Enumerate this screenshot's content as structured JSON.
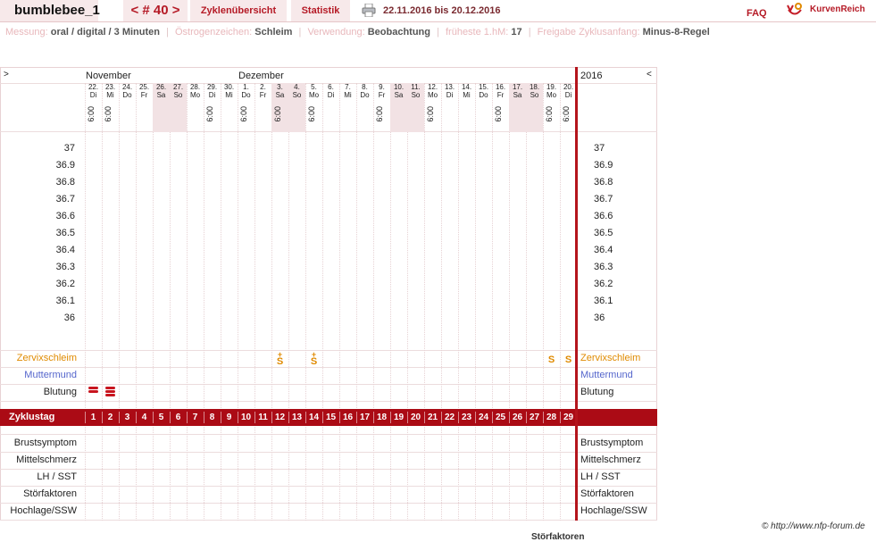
{
  "header": {
    "username": "bumblebee_1",
    "cycle_nav": {
      "prev": "<",
      "label": "# 40",
      "next": ">"
    },
    "tabs": [
      "Zyklenübersicht",
      "Statistik"
    ],
    "date_range": "22.11.2016 bis 20.12.2016",
    "faq": "FAQ",
    "brand": "KurvenReich"
  },
  "info": {
    "measure_label": "Messung:",
    "measure_value": "oral / digital / 3 Minuten",
    "estrogen_label": "Östrogenzeichen:",
    "estrogen_value": "Schleim",
    "usage_label": "Verwendung:",
    "usage_value": "Beobachtung",
    "earliest_label": "früheste 1.hM:",
    "earliest_value": "17",
    "release_label": "Freigabe Zyklusanfang:",
    "release_value": "Minus-8-Regel"
  },
  "chart": {
    "left_arrow": ">",
    "right_arrow": "<",
    "month1": "November",
    "month2": "Dezember",
    "year": "2016",
    "days": [
      {
        "d": "22.",
        "w": "Di",
        "t": "6:00",
        "we": false
      },
      {
        "d": "23.",
        "w": "Mi",
        "t": "6:00",
        "we": false
      },
      {
        "d": "24.",
        "w": "Do",
        "t": "",
        "we": false
      },
      {
        "d": "25.",
        "w": "Fr",
        "t": "",
        "we": false
      },
      {
        "d": "26.",
        "w": "Sa",
        "t": "",
        "we": true
      },
      {
        "d": "27.",
        "w": "So",
        "t": "",
        "we": true
      },
      {
        "d": "28.",
        "w": "Mo",
        "t": "",
        "we": false
      },
      {
        "d": "29.",
        "w": "Di",
        "t": "6:00",
        "we": false
      },
      {
        "d": "30.",
        "w": "Mi",
        "t": "",
        "we": false
      },
      {
        "d": "1.",
        "w": "Do",
        "t": "6:00",
        "we": false
      },
      {
        "d": "2.",
        "w": "Fr",
        "t": "",
        "we": false
      },
      {
        "d": "3.",
        "w": "Sa",
        "t": "6:00",
        "we": true
      },
      {
        "d": "4.",
        "w": "So",
        "t": "",
        "we": true
      },
      {
        "d": "5.",
        "w": "Mo",
        "t": "6:00",
        "we": false
      },
      {
        "d": "6.",
        "w": "Di",
        "t": "",
        "we": false
      },
      {
        "d": "7.",
        "w": "Mi",
        "t": "",
        "we": false
      },
      {
        "d": "8.",
        "w": "Do",
        "t": "",
        "we": false
      },
      {
        "d": "9.",
        "w": "Fr",
        "t": "6:00",
        "we": false
      },
      {
        "d": "10.",
        "w": "Sa",
        "t": "",
        "we": true
      },
      {
        "d": "11.",
        "w": "So",
        "t": "",
        "we": true
      },
      {
        "d": "12.",
        "w": "Mo",
        "t": "6:00",
        "we": false
      },
      {
        "d": "13.",
        "w": "Di",
        "t": "",
        "we": false
      },
      {
        "d": "14.",
        "w": "Mi",
        "t": "",
        "we": false
      },
      {
        "d": "15.",
        "w": "Do",
        "t": "",
        "we": false
      },
      {
        "d": "16.",
        "w": "Fr",
        "t": "6:00",
        "we": false
      },
      {
        "d": "17.",
        "w": "Sa",
        "t": "",
        "we": true
      },
      {
        "d": "18.",
        "w": "So",
        "t": "",
        "we": true
      },
      {
        "d": "19.",
        "w": "Mo",
        "t": "6:00",
        "we": false
      },
      {
        "d": "20.",
        "w": "Di",
        "t": "6:00",
        "we": false
      }
    ],
    "temps": [
      "37",
      "36.9",
      "36.8",
      "36.7",
      "36.6",
      "36.5",
      "36.4",
      "36.3",
      "36.2",
      "36.1",
      "36"
    ],
    "rows": {
      "zervix": "Zervixschleim",
      "mutter": "Muttermund",
      "blutung": "Blutung",
      "zyklustag": "Zyklustag",
      "bottom": [
        "Brustsymptom",
        "Mittelschmerz",
        "LH / SST",
        "Störfaktoren",
        "Hochlage/SSW"
      ]
    },
    "mucus_marks": [
      {
        "day": 12,
        "sym": "S",
        "plus": true
      },
      {
        "day": 14,
        "sym": "S",
        "plus": true
      },
      {
        "day": 28,
        "sym": "S",
        "plus": false
      },
      {
        "day": 29,
        "sym": "S",
        "plus": false
      }
    ],
    "bleeding_days": [
      1,
      2
    ],
    "cycle_days": [
      "1",
      "2",
      "3",
      "4",
      "5",
      "6",
      "7",
      "8",
      "9",
      "10",
      "11",
      "12",
      "13",
      "14",
      "15",
      "16",
      "17",
      "18",
      "19",
      "20",
      "21",
      "22",
      "23",
      "24",
      "25",
      "26",
      "27",
      "28",
      "29"
    ],
    "colors": {
      "accent": "#ab0b15",
      "mucus": "#e08a00",
      "mutter": "#5566cc",
      "zervix": "#e08a00",
      "weekend": "#f2e2e4"
    }
  },
  "footer": {
    "copyright": "© http://www.nfp-forum.de",
    "cut_label": "Störfaktoren"
  }
}
